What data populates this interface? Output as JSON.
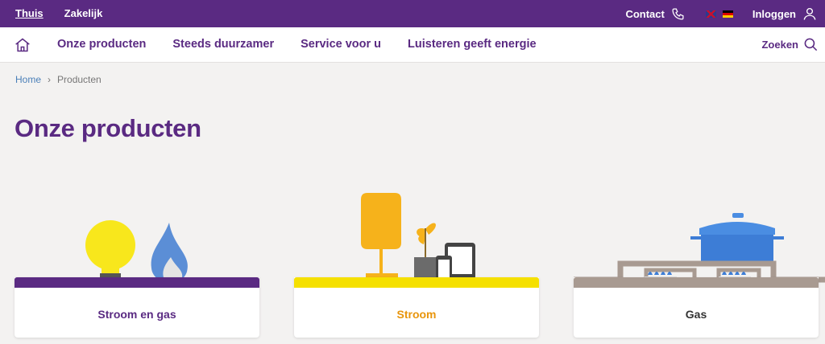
{
  "topbar": {
    "segments": [
      "Thuis",
      "Zakelijk"
    ],
    "contact_label": "Contact",
    "login_label": "Inloggen"
  },
  "nav": {
    "items": [
      "Onze producten",
      "Steeds duurzamer",
      "Service voor u",
      "Luisteren geeft energie"
    ],
    "search_label": "Zoeken"
  },
  "breadcrumb": {
    "home": "Home",
    "current": "Producten"
  },
  "page": {
    "title": "Onze producten"
  },
  "products": [
    {
      "label": "Stroom en gas",
      "bar_color": "#5a2a82",
      "label_color": "#5a2a82"
    },
    {
      "label": "Stroom",
      "bar_color": "#f5e000",
      "label_color": "#e8950c"
    },
    {
      "label": "Gas",
      "bar_color": "#a89a91",
      "label_color": "#333333"
    }
  ],
  "colors": {
    "brand_purple": "#5a2a82",
    "link_blue": "#4a7fb8"
  }
}
